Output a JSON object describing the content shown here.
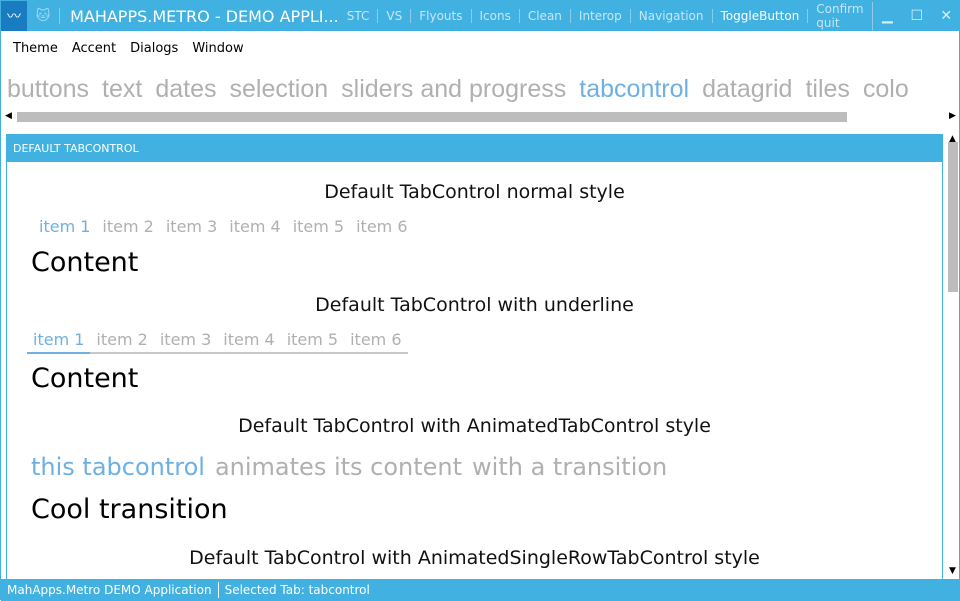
{
  "titlebar": {
    "title": "MAHAPPS.METRO - DEMO APPLI...",
    "commands": [
      {
        "label": "STC",
        "active": false
      },
      {
        "label": "VS",
        "active": false
      },
      {
        "label": "Flyouts",
        "active": false
      },
      {
        "label": "Icons",
        "active": false
      },
      {
        "label": "Clean",
        "active": false
      },
      {
        "label": "Interop",
        "active": false
      },
      {
        "label": "Navigation",
        "active": false
      },
      {
        "label": "ToggleButton",
        "active": true
      },
      {
        "label": "Confirm quit",
        "active": false
      }
    ],
    "minimize": "▁",
    "maximize": "☐",
    "close": "✕"
  },
  "menu": [
    "Theme",
    "Accent",
    "Dialogs",
    "Window"
  ],
  "main_tabs": [
    {
      "label": "buttons"
    },
    {
      "label": "text"
    },
    {
      "label": "dates"
    },
    {
      "label": "selection"
    },
    {
      "label": "sliders and progress"
    },
    {
      "label": "tabcontrol",
      "selected": true
    },
    {
      "label": "datagrid"
    },
    {
      "label": "tiles"
    },
    {
      "label": "colo"
    }
  ],
  "panel": {
    "header": "DEFAULT TABCONTROL",
    "section1": {
      "title": "Default TabControl normal style",
      "tabs": [
        "item 1",
        "item 2",
        "item 3",
        "item 4",
        "item 5",
        "item 6"
      ],
      "content": "Content"
    },
    "section2": {
      "title": "Default TabControl with underline",
      "tabs": [
        "item 1",
        "item 2",
        "item 3",
        "item 4",
        "item 5",
        "item 6"
      ],
      "content": "Content"
    },
    "section3": {
      "title": "Default TabControl with AnimatedTabControl style",
      "tabs": [
        "this tabcontrol",
        "animates its content",
        "with a transition"
      ],
      "content": "Cool transition"
    },
    "section4": {
      "title": "Default TabControl with AnimatedSingleRowTabControl style"
    }
  },
  "status": {
    "app": "MahApps.Metro DEMO Application",
    "selected": "Selected Tab:  tabcontrol"
  },
  "colors": {
    "accent": "#41b1e1",
    "selected_tab": "#6fb0e4"
  }
}
